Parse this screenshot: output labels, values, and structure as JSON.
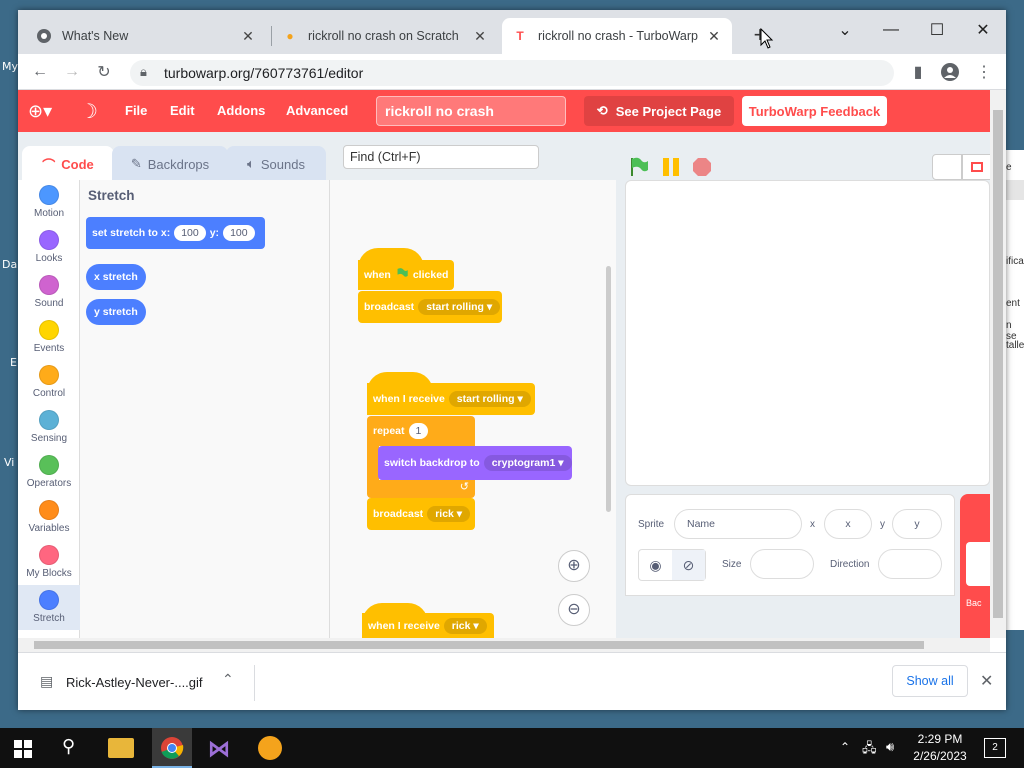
{
  "desktop": {
    "labels": [
      "My",
      "Da",
      "E",
      "Vi"
    ]
  },
  "behind_window": {
    "labels": [
      "e",
      "ifica",
      "ent",
      "n se",
      "talle"
    ]
  },
  "browser": {
    "tabs": [
      {
        "title": "What's New",
        "favicon": "chrome-icon",
        "active": false
      },
      {
        "title": "rickroll no crash on Scratch",
        "favicon": "scratch-cat-icon",
        "active": false
      },
      {
        "title": "rickroll no crash - TurboWarp",
        "favicon": "turbowarp-icon",
        "active": true
      }
    ],
    "new_tab": "+",
    "url": "turbowarp.org/760773761/editor"
  },
  "turbowarp": {
    "menu": {
      "file": "File",
      "edit": "Edit",
      "addons": "Addons",
      "advanced": "Advanced"
    },
    "project_title": "rickroll no crash",
    "see_project_page": "See Project Page",
    "feedback": "TurboWarp Feedback",
    "editor_tabs": {
      "code": "Code",
      "backdrops": "Backdrops",
      "sounds": "Sounds"
    },
    "find_placeholder": "Find (Ctrl+F)",
    "categories": [
      {
        "label": "Motion",
        "color": "#4c97ff"
      },
      {
        "label": "Looks",
        "color": "#9966ff"
      },
      {
        "label": "Sound",
        "color": "#cf63cf"
      },
      {
        "label": "Events",
        "color": "#ffd500"
      },
      {
        "label": "Control",
        "color": "#ffab19"
      },
      {
        "label": "Sensing",
        "color": "#5cb1d6"
      },
      {
        "label": "Operators",
        "color": "#59c059"
      },
      {
        "label": "Variables",
        "color": "#ff8c1a"
      },
      {
        "label": "My Blocks",
        "color": "#ff6680"
      },
      {
        "label": "Stretch",
        "color": "#4c7fff"
      }
    ],
    "palette": {
      "heading": "Stretch",
      "set_stretch": {
        "text1": "set stretch to x:",
        "x": "100",
        "text2": "y:",
        "y": "100"
      },
      "x_stretch": "x stretch",
      "y_stretch": "y stretch"
    },
    "script1": {
      "hat": "when",
      "hat2": "clicked",
      "broadcast": "broadcast",
      "message": "start rolling"
    },
    "script2": {
      "hat": "when I receive",
      "message": "start rolling",
      "repeat": "repeat",
      "times": "1",
      "switch": "switch backdrop to",
      "backdrop": "cryptogram1",
      "broadcast": "broadcast",
      "message2": "rick"
    },
    "script3": {
      "hat": "when I receive",
      "message": "rick"
    },
    "sprite_info": {
      "sprite_label": "Sprite",
      "name_placeholder": "Name",
      "x_label": "x",
      "x_placeholder": "x",
      "y_label": "y",
      "y_placeholder": "y",
      "size_label": "Size",
      "direction_label": "Direction"
    },
    "backdrop_label": "Bac"
  },
  "download": {
    "filename": "Rick-Astley-Never-....gif",
    "show_all": "Show all"
  },
  "taskbar": {
    "time": "2:29 PM",
    "date": "2/26/2023",
    "notifications": "2"
  },
  "colors": {
    "accent": "#ff4c4c",
    "events": "#ffbf00",
    "control": "#ffab19",
    "looks": "#9966ff",
    "stretch": "#4c7fff"
  }
}
